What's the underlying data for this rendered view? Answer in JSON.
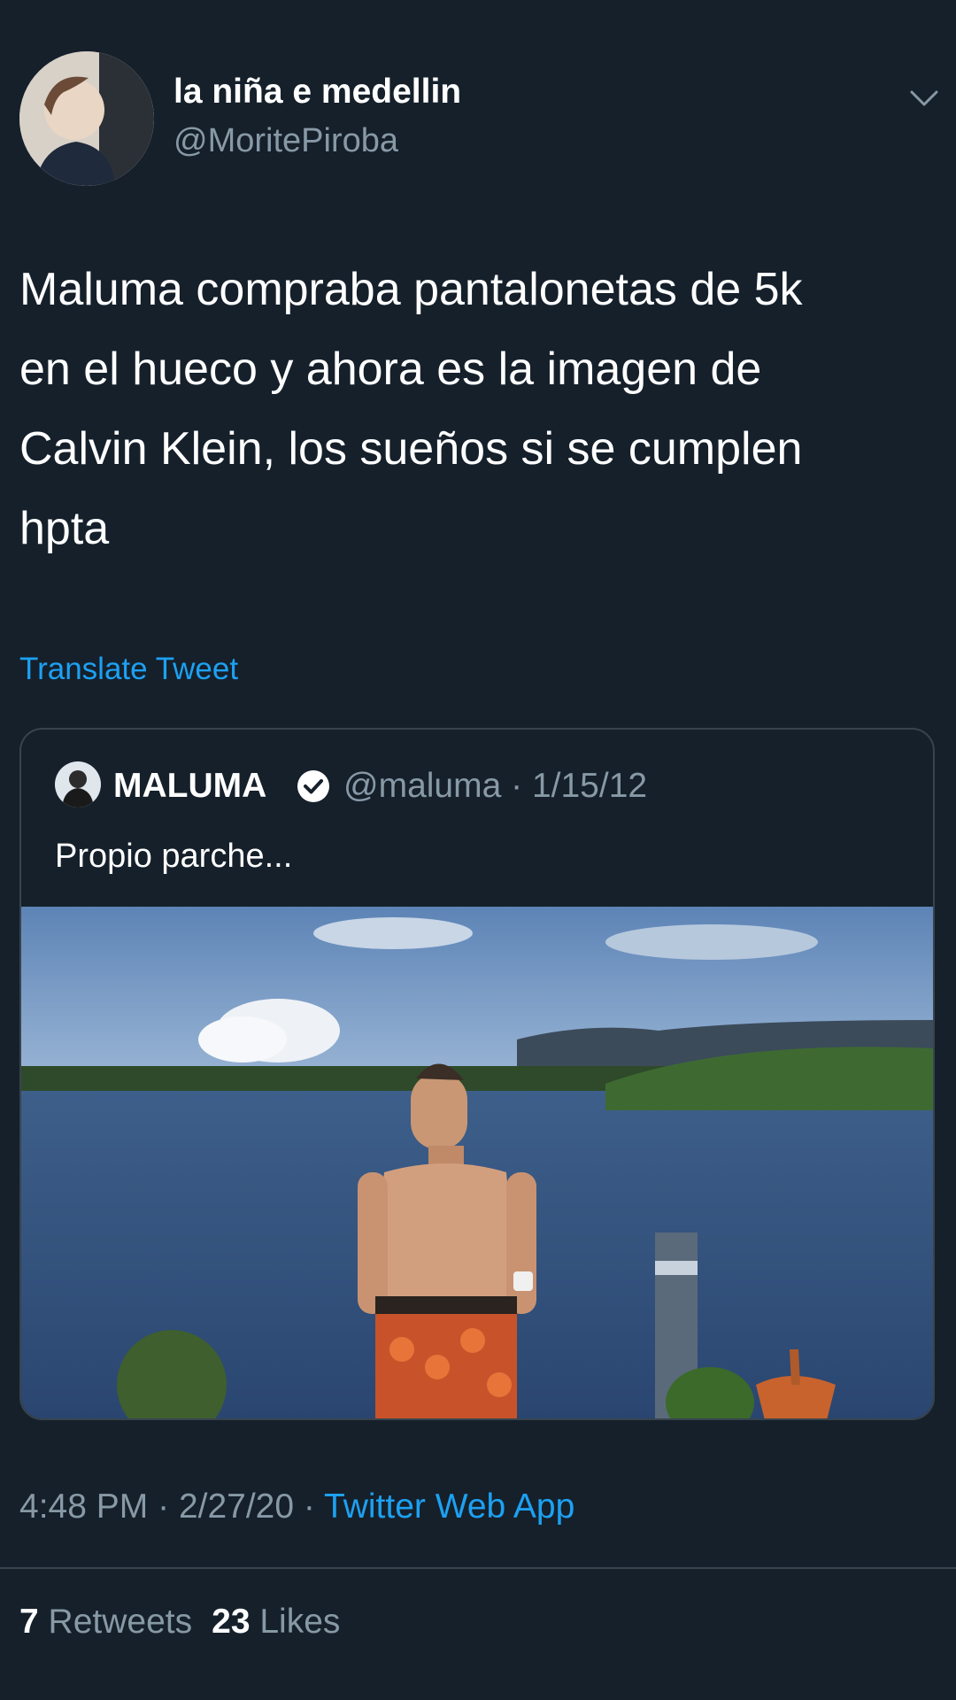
{
  "tweet": {
    "author": {
      "display_name": "la niña e medellin",
      "handle": "@MoritePiroba",
      "avatar_icon": "profile-photo"
    },
    "menu_icon": "chevron-down-icon",
    "text_lines": [
      "Maluma compraba pantalonetas de 5k",
      "en el hueco y ahora es la imagen de",
      "Calvin Klein, los sueños si se cumplen",
      "hpta"
    ],
    "translate_label": "Translate Tweet",
    "time": "4:48 PM",
    "date": "2/27/20",
    "separator": "·",
    "source": "Twitter Web App",
    "retweets_count": "7",
    "retweets_label": "Retweets",
    "likes_count": "23",
    "likes_label": "Likes"
  },
  "quoted": {
    "display_name": "MALUMA",
    "verified_icon": "verified-badge-icon",
    "handle_date": "@maluma · 1/15/12",
    "text": "Propio parche...",
    "media_icon": "lake-photo"
  },
  "colors": {
    "background": "#15202b",
    "secondary_text": "#8899a6",
    "accent": "#1da1f2",
    "border": "#38444d"
  }
}
